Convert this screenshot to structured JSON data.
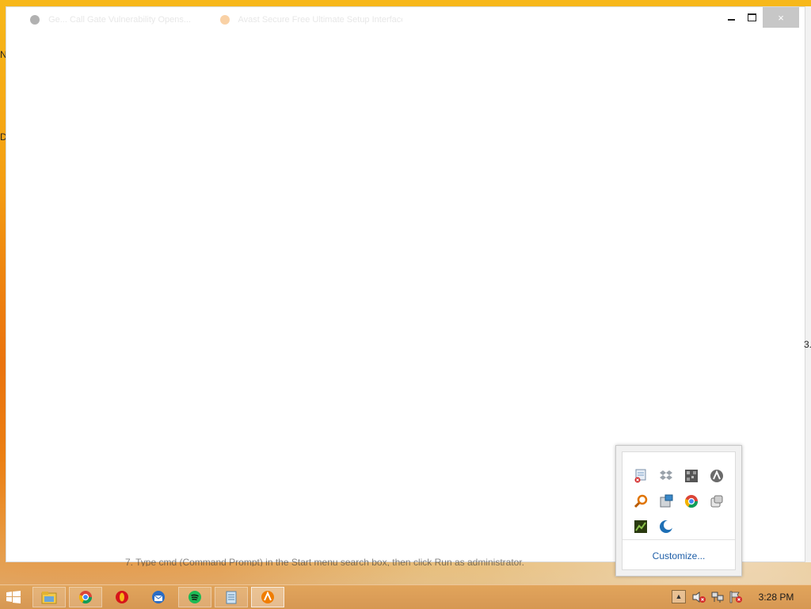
{
  "browser": {
    "tabs": [
      {
        "label": "Ge... Call Gate Vulnerability Opens..."
      },
      {
        "label": "Avast Secure Free Ultimate Setup Interface..."
      }
    ],
    "window_buttons": {
      "minimize": "minimize",
      "maximize": "maximize",
      "close": "×"
    },
    "bottom_text": "7. Type cmd (Command Prompt) in the Start menu search box, then click Run as administrator."
  },
  "page_fragments": {
    "left_top": "N",
    "left_mid": "D",
    "right_mid": "3."
  },
  "tray_popup": {
    "icons": [
      {
        "name": "network-error-icon"
      },
      {
        "name": "dropbox-icon"
      },
      {
        "name": "qr-app-icon"
      },
      {
        "name": "avast-icon"
      },
      {
        "name": "search-tool-icon"
      },
      {
        "name": "screen-capture-icon"
      },
      {
        "name": "chrome-remote-icon"
      },
      {
        "name": "device-icon"
      },
      {
        "name": "nvidia-icon"
      },
      {
        "name": "moon-app-icon"
      }
    ],
    "customize_label": "Customize..."
  },
  "taskbar": {
    "items": [
      {
        "name": "file-explorer-icon"
      },
      {
        "name": "chrome-icon"
      },
      {
        "name": "opera-icon"
      },
      {
        "name": "thunderbird-icon"
      },
      {
        "name": "spotify-icon"
      },
      {
        "name": "notepad-icon"
      },
      {
        "name": "avast-taskbar-icon"
      }
    ],
    "show_hidden_label": "▲",
    "clock": "3:28 PM"
  }
}
